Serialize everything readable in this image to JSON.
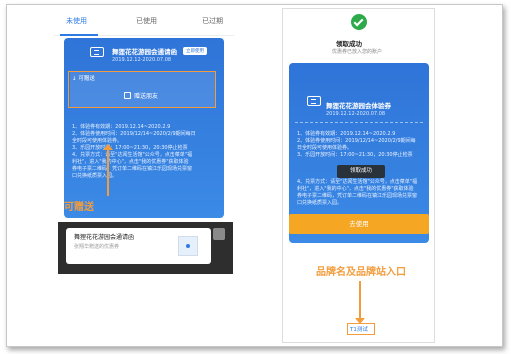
{
  "left": {
    "tabs": [
      "未使用",
      "已使用",
      "已过期"
    ],
    "coupon": {
      "title": "舞狸花花游园会通请函",
      "date_range": "2019.12.12-2020.07.08",
      "badge": "立即使用",
      "gift_label": "↓ 可赠送",
      "gift_button": "赠送朋友",
      "rules": [
        "1、体验券有效期：2019.12.14~2020.2.9",
        "2、体验券使用时间：2019/12/14~2020/2/9期间每日",
        "全时段可使用体验券。",
        "3、乐园开放时间：17:00~21:30，20:30停止检票",
        "4、兑票方式：请至\"达闻生活馆\"公众号，点击菜单\"福",
        "利社\"，进入\"我的中心\"，点击\"我的优惠券\"获取体验",
        "券电子票二维码，凭订单二维码在镇江乐园现场兑票窗",
        "口兑换纸质票入园。"
      ]
    },
    "annotation": "可赠送",
    "share": {
      "title": "舞狸花花游园会通请函",
      "subtitle": "张翔华赠送的优惠券"
    }
  },
  "right": {
    "success_title": "领取成功",
    "success_sub": "优惠券已放入您的账户",
    "coupon": {
      "title": "舞狸花花游园会体验券",
      "date_range": "2019.12.12-2020.07.08",
      "rules": [
        "1、体验券有效期：2019.12.14~2020.2.9",
        "2、体验券使用时间：2019/12/14~2020/2/9期间每",
        "日全时段可使用体验券。",
        "3、乐园开放时间：17:00~21:30，20:30停止检票",
        "4、兑票方式：请至\"达闻生活馆\"公众号，点击菜单\"福",
        "利社\"，进入\"我的中心\"，点击\"我的优惠券\"获取体验",
        "券电子票二维码，凭订单二维码在镇江乐园现场兑票窗",
        "口兑换纸质票入园。"
      ]
    },
    "toast": "领取成功",
    "use_button": "去使用",
    "annotation": "品牌名及品牌站入口",
    "brand_link": "T1测试"
  },
  "colors": {
    "accent": "#2f7be5",
    "card_blue": "#2f74d8",
    "annotation": "#f39c3c",
    "use_button": "#f5a623",
    "success": "#2faa4a"
  },
  "icons": [
    "ticket-icon",
    "check-icon",
    "gift-icon",
    "avatar-icon"
  ]
}
